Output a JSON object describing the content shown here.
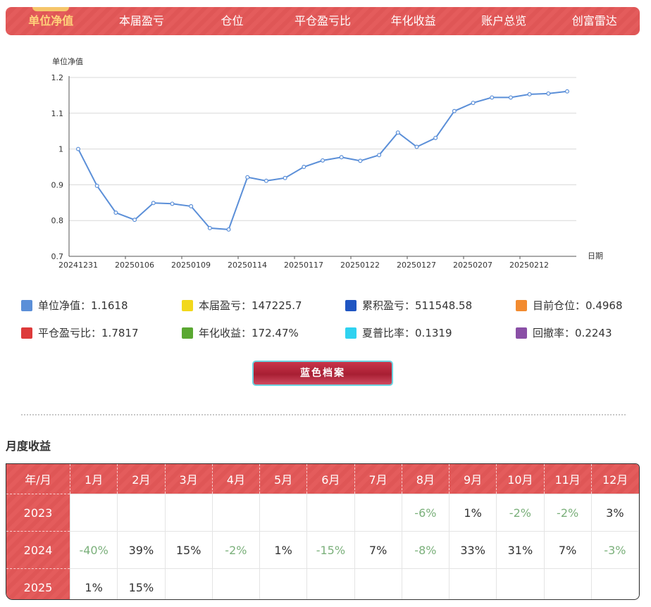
{
  "tabs": [
    "单位净值",
    "本届盈亏",
    "仓位",
    "平仓盈亏比",
    "年化收益",
    "账户总览",
    "创富雷达"
  ],
  "active_tab": 0,
  "chart_data": {
    "type": "line",
    "ylabel": "单位净值",
    "xlabel": "日期",
    "ylim": [
      0.7,
      1.2
    ],
    "yticks": [
      "0.7",
      "0.8",
      "0.9",
      "1",
      "1.1",
      "1.2"
    ],
    "xtick_labels": [
      "20241231",
      "20250106",
      "20250109",
      "20250114",
      "20250117",
      "20250122",
      "20250127",
      "20250207",
      "20250212"
    ],
    "grid": true,
    "color": "#5b8fd8",
    "values": [
      1.0,
      0.897,
      0.822,
      0.802,
      0.849,
      0.847,
      0.84,
      0.779,
      0.775,
      0.921,
      0.911,
      0.919,
      0.95,
      0.968,
      0.977,
      0.967,
      0.983,
      1.046,
      1.006,
      1.031,
      1.106,
      1.129,
      1.144,
      1.144,
      1.153,
      1.155,
      1.161
    ]
  },
  "legend": [
    {
      "label": "单位净值：",
      "value": "1.1618",
      "color": "#5b8fd8"
    },
    {
      "label": "本届盈亏：",
      "value": "147225.7",
      "color": "#f2d81c"
    },
    {
      "label": "累积盈亏：",
      "value": "511548.58",
      "color": "#1f55c2"
    },
    {
      "label": "目前仓位：",
      "value": "0.4968",
      "color": "#f28b30"
    },
    {
      "label": "平仓盈亏比：",
      "value": "1.7817",
      "color": "#dd3a3a"
    },
    {
      "label": "年化收益：",
      "value": "172.47%",
      "color": "#5aa832"
    },
    {
      "label": "夏普比率：",
      "value": "0.1319",
      "color": "#2fd2f0"
    },
    {
      "label": "回撤率：",
      "value": "0.2243",
      "color": "#8a4fa6"
    }
  ],
  "button_label": "蓝色档案",
  "monthly": {
    "title": "月度收益",
    "header": [
      "年/月",
      "1月",
      "2月",
      "3月",
      "4月",
      "5月",
      "6月",
      "7月",
      "8月",
      "9月",
      "10月",
      "11月",
      "12月"
    ],
    "rows": [
      {
        "year": "2023",
        "cells": [
          "",
          "",
          "",
          "",
          "",
          "",
          "",
          "-6%",
          "1%",
          "-2%",
          "-2%",
          "3%"
        ]
      },
      {
        "year": "2024",
        "cells": [
          "-40%",
          "39%",
          "15%",
          "-2%",
          "1%",
          "-15%",
          "7%",
          "-8%",
          "33%",
          "31%",
          "7%",
          "-3%"
        ]
      },
      {
        "year": "2025",
        "cells": [
          "1%",
          "15%",
          "",
          "",
          "",
          "",
          "",
          "",
          "",
          "",
          "",
          ""
        ]
      }
    ],
    "negative_color": "#7bb07b"
  }
}
